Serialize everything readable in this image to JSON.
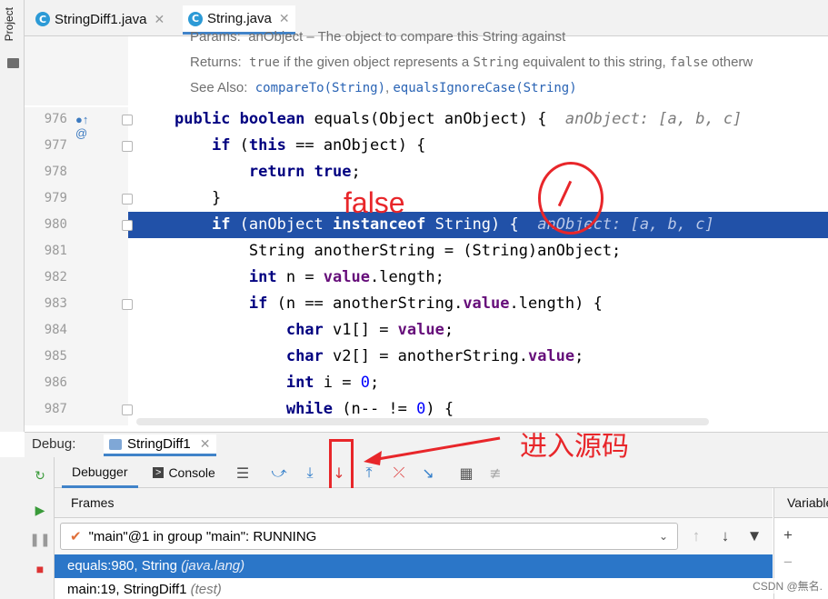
{
  "sidebar": {
    "project_label": "Project"
  },
  "tabs": [
    {
      "label": "StringDiff1.java",
      "icon": "C",
      "active": false
    },
    {
      "label": "String.java",
      "icon": "C",
      "active": true
    }
  ],
  "javadoc": {
    "params_label": "Params:",
    "params_text": "anObject – The object to compare this String against",
    "returns_label": "Returns:",
    "returns_true": "true",
    "returns_text_a": " if the given object represents a ",
    "returns_string": "String",
    "returns_text_b": " equivalent to this string, ",
    "returns_false": "false",
    "returns_text_c": " otherw",
    "see_also_label": "See Also:",
    "see_also_1": "compareTo(String)",
    "see_also_sep": ", ",
    "see_also_2": "equalsIgnoreCase(String)"
  },
  "code": {
    "lines": [
      {
        "num": "976"
      },
      {
        "num": "977"
      },
      {
        "num": "978"
      },
      {
        "num": "979"
      },
      {
        "num": "980"
      },
      {
        "num": "981"
      },
      {
        "num": "982"
      },
      {
        "num": "983"
      },
      {
        "num": "984"
      },
      {
        "num": "985"
      },
      {
        "num": "986"
      },
      {
        "num": "987"
      }
    ],
    "t": {
      "public": "public",
      "boolean": "boolean",
      "equals_sig": " equals(Object anObject) {",
      "hint976": "anObject: [a, b, c]",
      "if": "if",
      "this": "this",
      "eq_anobj": " == anObject) {",
      "return": "return",
      "true": "true",
      "semi": ";",
      "close": "}",
      "instanceof": "instanceof",
      "if_open": " (anObject ",
      "string_open": " String) {",
      "hint980": "anObject: [a, b, c]",
      "line981": "String anotherString = (String)anObject;",
      "int": "int",
      "n_assign": " n = ",
      "value": "value",
      "length_semi": ".length;",
      "n_eq": " (n == anotherString.",
      "length_open": ".length) {",
      "char": "char",
      "v1": " v1[] = ",
      "value_semi": ";",
      "v2": " v2[] = anotherString.",
      "i_assign": " i = ",
      "zero": "0",
      "while": "while",
      "while_rest": " (n-- != ",
      "while_end": ") {"
    }
  },
  "annotations": {
    "false_label": "false",
    "enter_source": "进入源码"
  },
  "debug": {
    "label": "Debug:",
    "session": "StringDiff1",
    "tab_debugger": "Debugger",
    "tab_console": "Console",
    "frames_title": "Frames",
    "variables_title": "Variables",
    "thread": "\"main\"@1 in group \"main\": RUNNING",
    "frames": [
      {
        "method": "equals:980, String ",
        "pkg": "(java.lang)",
        "selected": true
      },
      {
        "method": "main:19, StringDiff1 ",
        "pkg": "(test)",
        "selected": false
      }
    ]
  },
  "watermark": "CSDN @無名."
}
